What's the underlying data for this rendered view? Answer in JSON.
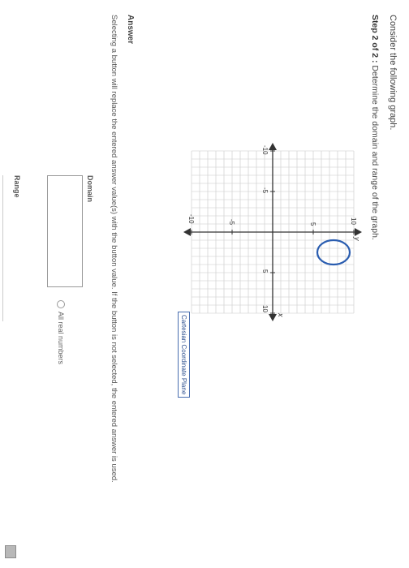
{
  "question": {
    "prompt": "Consider the following graph.",
    "step_prefix": "Step 2 of 2 :",
    "step_text": " Determine the domain and range of the graph."
  },
  "graph": {
    "axis_x_label": "x",
    "axis_y_label": "y",
    "tick_labels": {
      "x_neg10": "-10",
      "x_neg5": "-5",
      "x_pos5": "5",
      "x_pos10": "10",
      "y_pos10": "10",
      "y_pos5": "5",
      "y_neg5": "-5",
      "y_neg10": "-10"
    },
    "caption": "Cartesian Coordinate Plane",
    "colors": {
      "grid": "#c8c8c8",
      "axis": "#333333",
      "curve": "#2a5db0"
    }
  },
  "answer": {
    "heading": "Answer",
    "help_text": "Selecting a button will replace the entered answer value(s) with the button value. If the button is not selected, the entered answer is used.",
    "domain_label": "Domain",
    "domain_value": "",
    "all_real_label": "All real numbers",
    "range_label": "Range"
  }
}
